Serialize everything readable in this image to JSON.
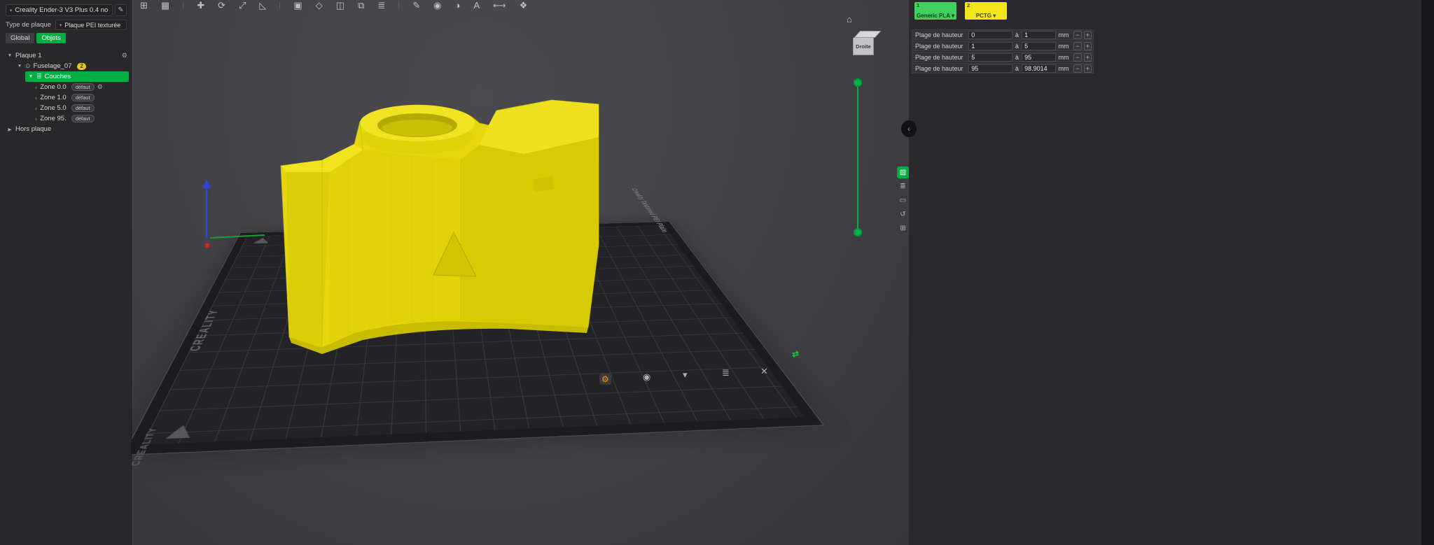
{
  "colors": {
    "accent_green": "#00ae42",
    "filament_1_color": "#3fd05f",
    "filament_2_color": "#f5e61c",
    "model_yellow": "#e5d70a",
    "badge_yellow": "#e9c81a"
  },
  "icons": {
    "caret_down": "▼",
    "caret_right": "▶",
    "caret_small": "▾",
    "gear": "⚙",
    "eye": "⊙",
    "layers": "≣",
    "modifier_box": "▫",
    "pencil": "✎",
    "home": "⌂",
    "collapse_arrow": "‹",
    "green_arrows": "⇄"
  },
  "left_panel": {
    "printer": {
      "value": "Creality Ender-3 V3 Plus 0.4 no"
    },
    "plate_type": {
      "label": "Type de plaque",
      "value": "Plaque PEI texturée"
    },
    "tabs": {
      "global": "Global",
      "objects": "Objets"
    },
    "tree": {
      "plate_row": {
        "label": "Plaque 1"
      },
      "object_row": {
        "label": "Fuselage_07",
        "badge": "2"
      },
      "layers_row": {
        "label": "Couches"
      },
      "zones": [
        {
          "label": "Zone 0.0",
          "badge": "défaut"
        },
        {
          "label": "Zone 1.0",
          "badge": "défaut"
        },
        {
          "label": "Zone 5.0",
          "badge": "défaut"
        },
        {
          "label": "Zone 95.",
          "badge": "défaut"
        }
      ],
      "off_plate_row": {
        "label": "Hors plaque"
      }
    }
  },
  "toolbar": {
    "icons": [
      {
        "name": "add-object",
        "glyph": "⊞"
      },
      {
        "name": "add-plate",
        "glyph": "▦"
      },
      {
        "name": "move",
        "glyph": "✚"
      },
      {
        "name": "rotate",
        "glyph": "⟳"
      },
      {
        "name": "scale",
        "glyph": "⤢"
      },
      {
        "name": "lay-flat",
        "glyph": "◺"
      },
      {
        "name": "arrange",
        "glyph": "▣"
      },
      {
        "name": "auto-orient",
        "glyph": "◇"
      },
      {
        "name": "split-objects",
        "glyph": "◫"
      },
      {
        "name": "split-parts",
        "glyph": "⧉"
      },
      {
        "name": "variable-layer-height",
        "glyph": "≣"
      },
      {
        "name": "support-paint",
        "glyph": "✎"
      },
      {
        "name": "seam-paint",
        "glyph": "◉"
      },
      {
        "name": "color-paint",
        "glyph": "◑"
      },
      {
        "name": "text-tool",
        "glyph": "A"
      },
      {
        "name": "measure",
        "glyph": "⟷"
      },
      {
        "name": "assembly",
        "glyph": "❖"
      }
    ]
  },
  "viewport": {
    "view_cube_label": "Droite",
    "plate": {
      "brand": "CREALITY",
      "name": "Creality Textured PEI Plate"
    },
    "plate_toolbar": [
      {
        "name": "plate-settings",
        "glyph": "⚙"
      },
      {
        "name": "plate-lock",
        "glyph": "◉"
      },
      {
        "name": "plate-arrange",
        "glyph": "▾"
      },
      {
        "name": "plate-name",
        "glyph": "≣"
      },
      {
        "name": "plate-delete",
        "glyph": "✕"
      }
    ],
    "right_rail": [
      {
        "name": "height-range-tool",
        "glyph": "▧"
      },
      {
        "name": "layer-list",
        "glyph": "≣"
      },
      {
        "name": "bounding-box",
        "glyph": "▭"
      },
      {
        "name": "reset-view",
        "glyph": "↺"
      },
      {
        "name": "apps-grid",
        "glyph": "⊞"
      }
    ]
  },
  "right_panel": {
    "filaments": [
      {
        "index": "1",
        "name": "Generic PLA ▾"
      },
      {
        "index": "2",
        "name": "PCTG ▾"
      }
    ],
    "height_table": {
      "label": "Plage de hauteur",
      "to_label": "à",
      "unit": "mm",
      "minus": "−",
      "plus": "+",
      "rows": [
        {
          "from": "0",
          "to": "1"
        },
        {
          "from": "1",
          "to": "5"
        },
        {
          "from": "5",
          "to": "95"
        },
        {
          "from": "95",
          "to": "98.9014"
        }
      ]
    }
  }
}
